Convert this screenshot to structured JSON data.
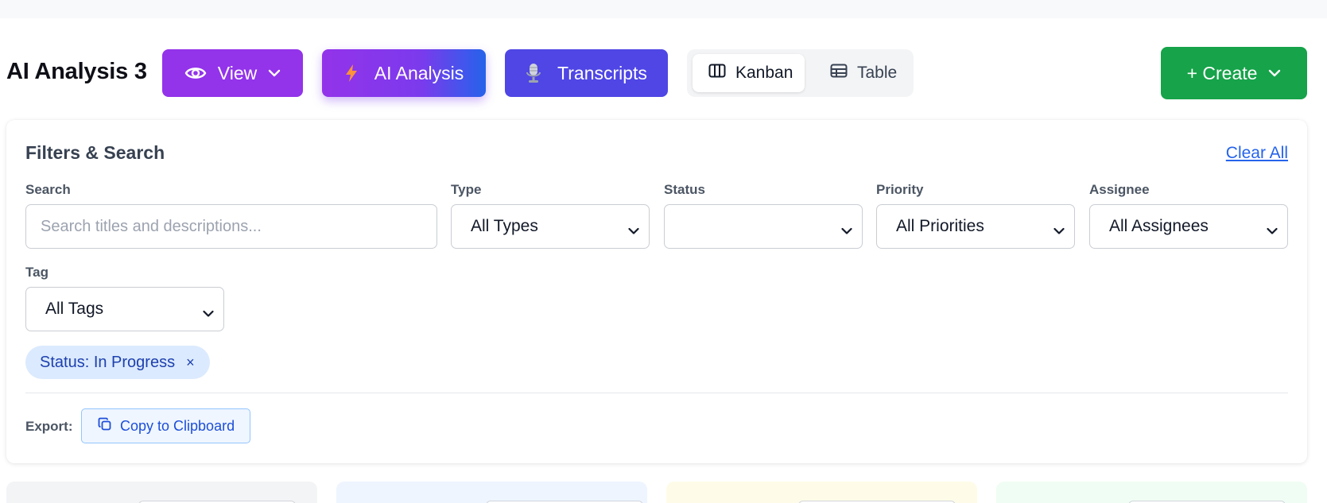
{
  "page": {
    "title": "AI Analysis 3"
  },
  "header": {
    "view_label": "View",
    "ai_analysis_label": "AI Analysis",
    "transcripts_label": "Transcripts",
    "kanban_label": "Kanban",
    "table_label": "Table",
    "create_label": "+ Create"
  },
  "filters": {
    "title": "Filters & Search",
    "clear_all": "Clear All",
    "search_label": "Search",
    "search_placeholder": "Search titles and descriptions...",
    "type_label": "Type",
    "type_value": "All Types",
    "status_label": "Status",
    "status_value": "",
    "priority_label": "Priority",
    "priority_value": "All Priorities",
    "assignee_label": "Assignee",
    "assignee_value": "All Assignees",
    "tag_label": "Tag",
    "tag_value": "All Tags",
    "active_chip": "Status: In Progress",
    "chip_remove": "×",
    "export_label": "Export:",
    "copy_label": "Copy to Clipboard"
  },
  "colors": {
    "view_button": "#9333ea",
    "transcripts_button": "#4f46e5",
    "create_button": "#16a34a",
    "link": "#2563eb",
    "chip_bg": "#dbeafe"
  },
  "columns": [
    {
      "color": "#f3f4f6"
    },
    {
      "color": "#eef5ff"
    },
    {
      "color": "#fefce8"
    },
    {
      "color": "#f0fdf4"
    }
  ]
}
